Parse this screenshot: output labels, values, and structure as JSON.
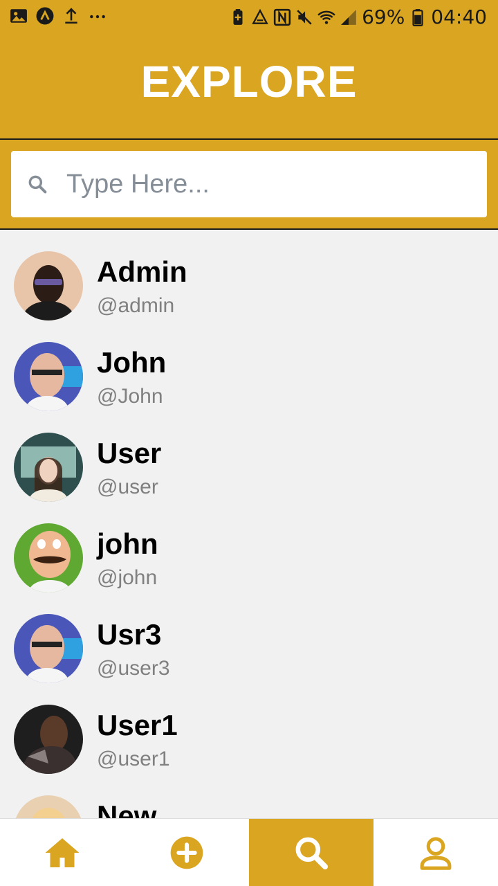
{
  "status_bar": {
    "battery_percent": "69%",
    "time": "04:40",
    "left_icons": [
      "image-icon",
      "a-circle-icon",
      "upload-icon",
      "more-dots-icon"
    ],
    "right_icons": [
      "battery-saver-icon",
      "recycle-icon",
      "nfc-icon",
      "mute-icon",
      "wifi-icon",
      "signal-icon",
      "battery-icon"
    ]
  },
  "header": {
    "title": "EXPLORE"
  },
  "search": {
    "placeholder": "Type Here..."
  },
  "users": [
    {
      "name": "Admin",
      "handle": "@admin",
      "avatar": "avatar-admin"
    },
    {
      "name": "John",
      "handle": "@John",
      "avatar": "avatar-john"
    },
    {
      "name": "User",
      "handle": "@user",
      "avatar": "avatar-user"
    },
    {
      "name": "john",
      "handle": "@john",
      "avatar": "avatar-cartoon"
    },
    {
      "name": "Usr3",
      "handle": "@user3",
      "avatar": "avatar-john"
    },
    {
      "name": "User1",
      "handle": "@user1",
      "avatar": "avatar-user1"
    },
    {
      "name": "New",
      "handle": "",
      "avatar": "avatar-new"
    }
  ],
  "bottom_nav": {
    "items": [
      {
        "icon": "home-icon",
        "active": false
      },
      {
        "icon": "add-circle-icon",
        "active": false
      },
      {
        "icon": "search-icon",
        "active": true
      },
      {
        "icon": "profile-icon",
        "active": false
      }
    ]
  },
  "colors": {
    "accent": "#daa520",
    "background": "#f1f1f1",
    "handle_text": "#808080",
    "placeholder": "#858d97"
  }
}
